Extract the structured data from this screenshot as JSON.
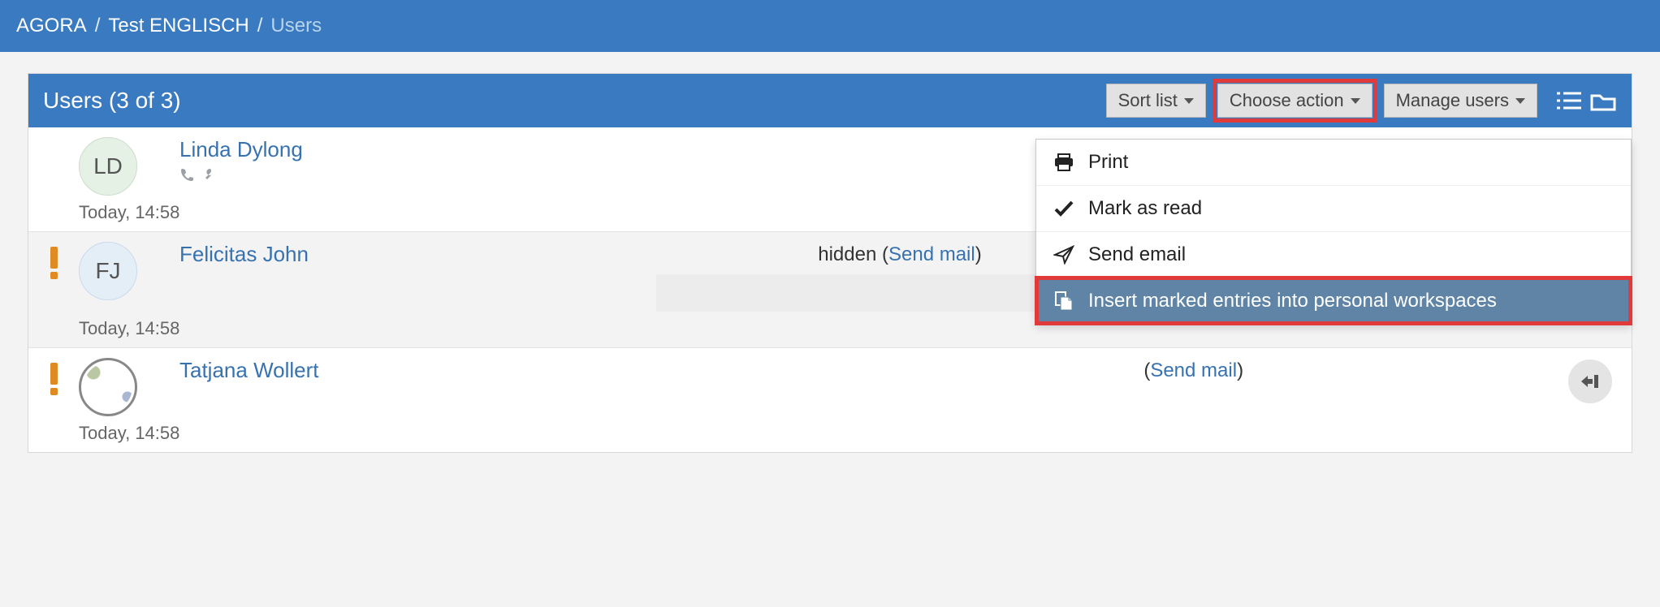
{
  "breadcrumb": {
    "root": "AGORA",
    "parent": "Test ENGLISCH",
    "current": "Users"
  },
  "panel": {
    "title": "Users (3 of 3)",
    "sort_label": "Sort list",
    "action_label": "Choose action",
    "manage_label": "Manage users"
  },
  "action_menu": {
    "print": "Print",
    "mark_read": "Mark as read",
    "send_email": "Send email",
    "insert": "Insert marked entries into personal workspaces"
  },
  "common": {
    "send_mail": "Send mail",
    "hidden_prefix": "hidden ("
  },
  "users": [
    {
      "initials": "LD",
      "name": "Linda Dylong",
      "timestamp": "Today, 14:58"
    },
    {
      "initials": "FJ",
      "name": "Felicitas John",
      "timestamp": "Today, 14:58"
    },
    {
      "name": "Tatjana Wollert",
      "timestamp": "Today, 14:58"
    }
  ]
}
